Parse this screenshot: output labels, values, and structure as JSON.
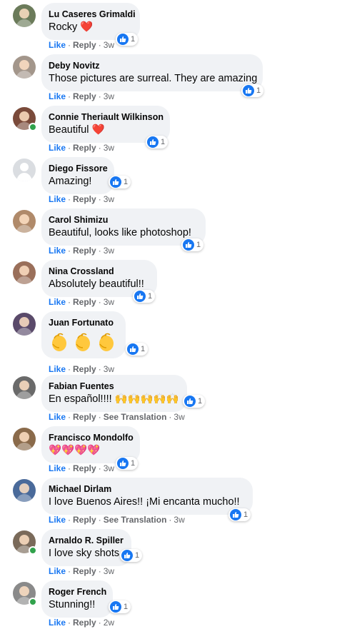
{
  "action_labels": {
    "like": "Like",
    "reply": "Reply",
    "see_translation": "See Translation",
    "separator": "·"
  },
  "comments": [
    {
      "author": "Lu Caseres Grimaldi",
      "text": "Rocky",
      "heart": "❤️",
      "reactions": "1",
      "time": "3w",
      "avatar_color": "#6b7b5a"
    },
    {
      "author": "Deby Novitz",
      "text": "Those pictures are surreal. They are amazing",
      "reactions": "1",
      "time": "3w",
      "avatar_color": "#a3968b"
    },
    {
      "author": "Connie Theriault Wilkinson",
      "text": "Beautiful",
      "heart": "❤️",
      "reactions": "1",
      "time": "3w",
      "avatar_color": "#7a4a3a",
      "online": true
    },
    {
      "author": "Diego Fissore",
      "text": "Amazing!",
      "reactions": "1",
      "time": "3w",
      "avatar_color": "#c8ccd1"
    },
    {
      "author": "Carol Shimizu",
      "text": "Beautiful, looks like photoshop!",
      "reactions": "1",
      "time": "3w",
      "avatar_color": "#b08a6a"
    },
    {
      "author": "Nina Crossland",
      "text": "Absolutely beautiful!!",
      "reactions": "1",
      "time": "3w",
      "avatar_color": "#9a6f5a"
    },
    {
      "author": "Juan Fortunato",
      "text": "",
      "emojis": [
        "👏",
        "👏",
        "👏"
      ],
      "reactions": "1",
      "time": "3w",
      "avatar_color": "#5a4a6a"
    },
    {
      "author": "Fabian Fuentes",
      "text": "En español!!!! 🙌🙌🙌🙌🙌",
      "reactions": "1",
      "time": "3w",
      "avatar_color": "#6a6a6a",
      "translation": true
    },
    {
      "author": "Francisco Mondolfo",
      "text": "💖💖💖💖",
      "reactions": "1",
      "time": "3w",
      "avatar_color": "#8a6a4a"
    },
    {
      "author": "Michael Dirlam",
      "text": "I love Buenos Aires!! ¡Mi encanta mucho!!",
      "reactions": "1",
      "time": "3w",
      "avatar_color": "#4a6a9a",
      "translation": true
    },
    {
      "author": "Arnaldo R. Spiller",
      "text": "I love sky shots",
      "reactions": "1",
      "time": "3w",
      "avatar_color": "#7a6a5a",
      "online": true
    },
    {
      "author": "Roger French",
      "text": "Stunning!!",
      "reactions": "1",
      "time": "2w",
      "avatar_color": "#8a8a8a",
      "online": true
    }
  ]
}
